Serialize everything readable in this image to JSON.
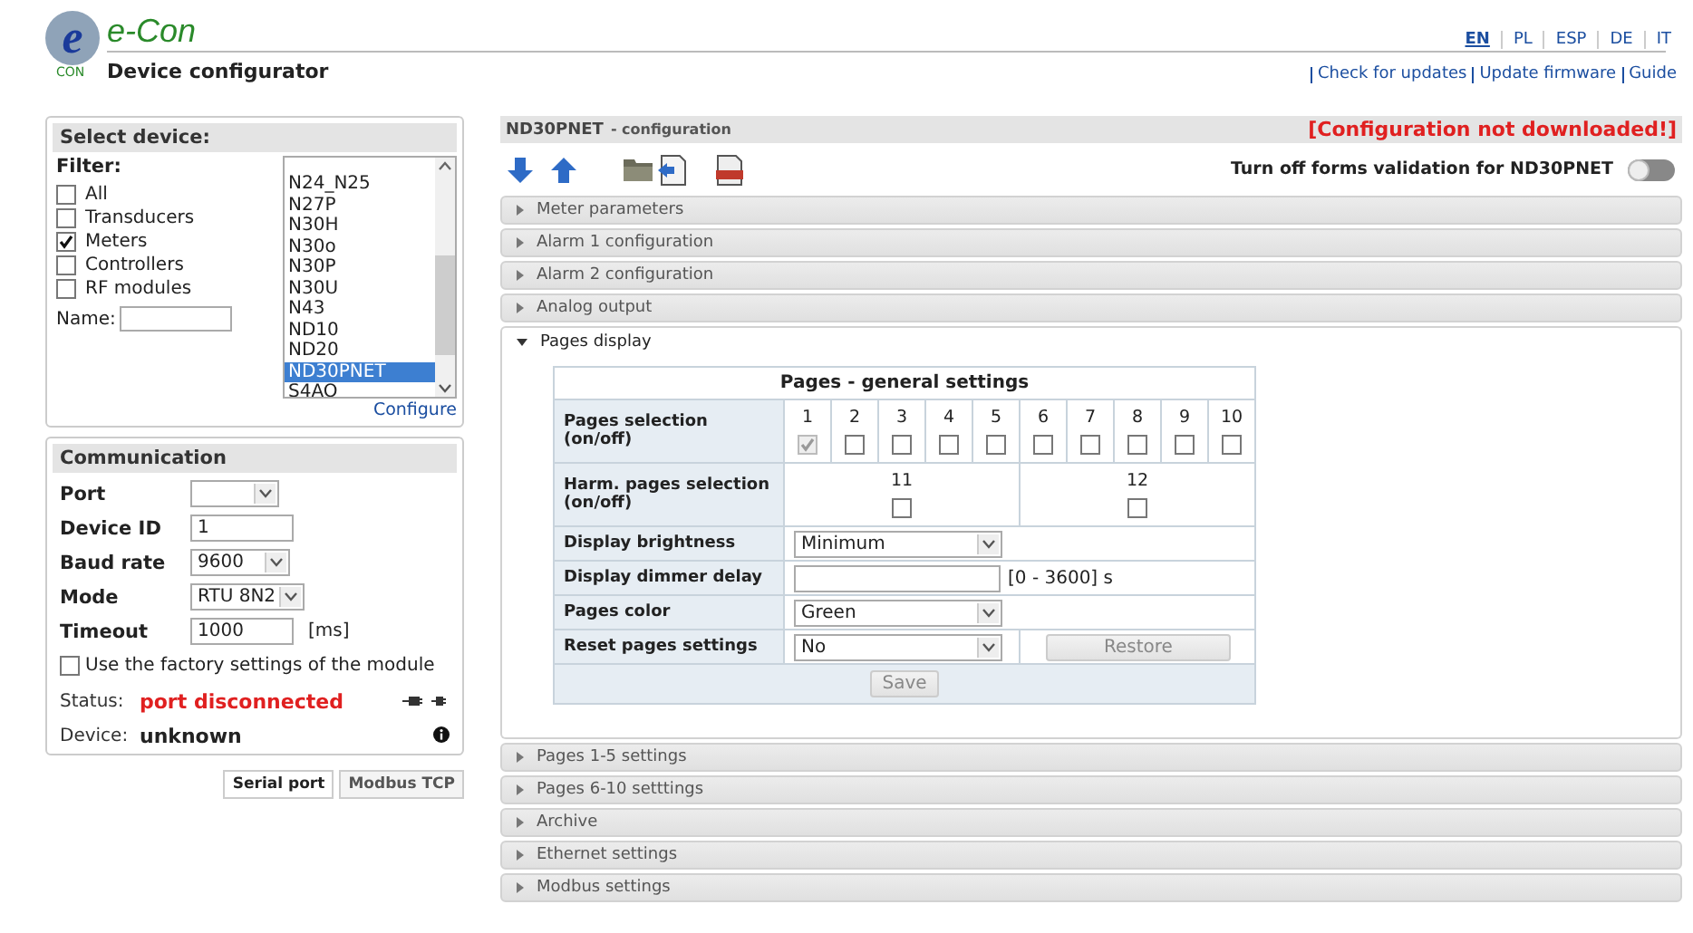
{
  "header": {
    "logo_letter": "e",
    "logo_sub": "CON",
    "brand": "e-Con",
    "subtitle": "Device configurator",
    "languages": [
      {
        "label": "EN",
        "selected": true
      },
      {
        "label": "PL",
        "selected": false
      },
      {
        "label": "ESP",
        "selected": false
      },
      {
        "label": "DE",
        "selected": false
      },
      {
        "label": "IT",
        "selected": false
      }
    ],
    "links": [
      "Check for updates",
      "Update firmware",
      "Guide"
    ]
  },
  "select_device": {
    "title": "Select device:",
    "filter_label": "Filter:",
    "filters": [
      {
        "label": "All",
        "checked": false
      },
      {
        "label": "Transducers",
        "checked": false
      },
      {
        "label": "Meters",
        "checked": true
      },
      {
        "label": "Controllers",
        "checked": false
      },
      {
        "label": "RF modules",
        "checked": false
      }
    ],
    "name_label": "Name:",
    "devices": [
      {
        "label": "N24_N25",
        "selected": false
      },
      {
        "label": "N27P",
        "selected": false
      },
      {
        "label": "N30H",
        "selected": false
      },
      {
        "label": "N30o",
        "selected": false
      },
      {
        "label": "N30P",
        "selected": false
      },
      {
        "label": "N30U",
        "selected": false
      },
      {
        "label": "N43",
        "selected": false
      },
      {
        "label": "ND10",
        "selected": false
      },
      {
        "label": "ND20",
        "selected": false
      },
      {
        "label": "ND30PNET",
        "selected": true
      },
      {
        "label": "S4AO",
        "selected": false
      }
    ],
    "configure_link": "Configure"
  },
  "communication": {
    "title": "Communication",
    "fields": [
      {
        "kind": "select",
        "label": "Port"
      },
      {
        "kind": "input",
        "label": "Device ID",
        "value": "1"
      },
      {
        "kind": "select",
        "label": "Baud rate",
        "value": "9600"
      },
      {
        "kind": "select",
        "label": "Mode",
        "value": "RTU 8N2"
      },
      {
        "kind": "input",
        "label": "Timeout",
        "value": "1000",
        "unit": "[ms]"
      }
    ],
    "factory": {
      "label": "Use the factory settings of the module",
      "checked": false
    },
    "status_label": "Status:",
    "status_value": "port disconnected",
    "device_label": "Device:",
    "device_value": "unknown",
    "tabs": [
      {
        "label": "Serial port",
        "selected": true
      },
      {
        "label": "Modbus TCP",
        "selected": false
      }
    ]
  },
  "config": {
    "title": "ND30PNET",
    "title_suffix": "- configuration",
    "warning": "[Configuration not downloaded!]",
    "validation_label": "Turn off forms validation for ND30PNET",
    "validation_on": false,
    "sections": [
      {
        "label": "Meter parameters",
        "expanded": false
      },
      {
        "label": "Alarm 1 configuration",
        "expanded": false
      },
      {
        "label": "Alarm 2 configuration",
        "expanded": false
      },
      {
        "label": "Analog output",
        "expanded": false
      },
      {
        "label": "Pages display",
        "expanded": true,
        "pages_table": {
          "title": "Pages - general settings",
          "selection_label": "Pages selection (on/off)",
          "pages": [
            {
              "label": "1",
              "checked": true,
              "disabled": true
            },
            {
              "label": "2",
              "checked": false,
              "disabled": false
            },
            {
              "label": "3",
              "checked": false,
              "disabled": false
            },
            {
              "label": "4",
              "checked": false,
              "disabled": false
            },
            {
              "label": "5",
              "checked": false,
              "disabled": false
            },
            {
              "label": "6",
              "checked": false,
              "disabled": false
            },
            {
              "label": "7",
              "checked": false,
              "disabled": false
            },
            {
              "label": "8",
              "checked": false,
              "disabled": false
            },
            {
              "label": "9",
              "checked": false,
              "disabled": false
            },
            {
              "label": "10",
              "checked": false,
              "disabled": false
            }
          ],
          "harm_label": "Harm. pages selection (on/off)",
          "harm_pages": [
            {
              "label": "11",
              "checked": false,
              "disabled": false
            },
            {
              "label": "12",
              "checked": false,
              "disabled": false
            }
          ],
          "rows": [
            {
              "kind": "select",
              "label": "Display brightness",
              "value": "Minimum"
            },
            {
              "kind": "input",
              "label": "Display dimmer delay",
              "hint": "[0 - 3600] s"
            },
            {
              "kind": "select",
              "label": "Pages color",
              "value": "Green"
            },
            {
              "kind": "select_button",
              "label": "Reset pages settings",
              "value": "No",
              "button": "Restore"
            }
          ],
          "save_button": "Save"
        }
      },
      {
        "label": "Pages 1-5 settings",
        "expanded": false
      },
      {
        "label": "Pages 6-10 setttings",
        "expanded": false
      },
      {
        "label": "Archive",
        "expanded": false
      },
      {
        "label": "Ethernet settings",
        "expanded": false
      },
      {
        "label": "Modbus settings",
        "expanded": false
      }
    ]
  }
}
